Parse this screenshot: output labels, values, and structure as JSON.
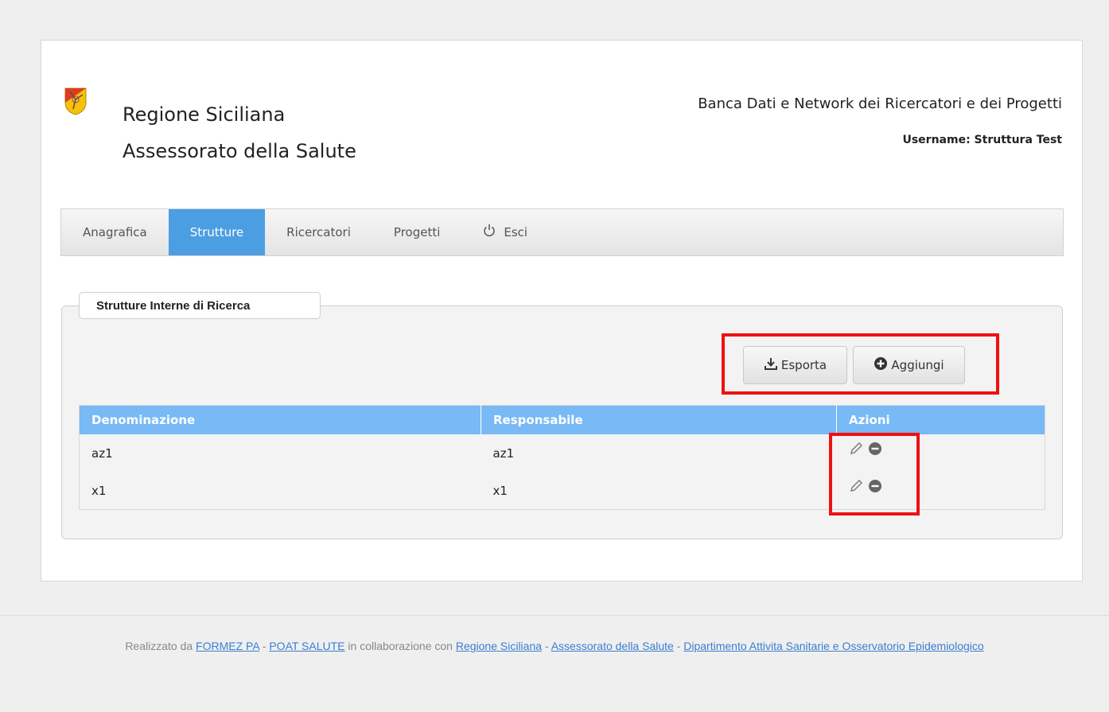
{
  "header": {
    "logo_icon": "trinacria-shield-logo",
    "org_line1": "Regione Siciliana",
    "org_line2": "Assessorato della Salute",
    "app_title": "Banca Dati e Network dei Ricercatori e dei Progetti",
    "username_label": "Username: Struttura Test"
  },
  "nav": {
    "items": [
      {
        "label": "Anagrafica",
        "active": false
      },
      {
        "label": "Strutture",
        "active": true
      },
      {
        "label": "Ricercatori",
        "active": false
      },
      {
        "label": "Progetti",
        "active": false
      },
      {
        "label": "Esci",
        "active": false,
        "icon": "power-icon"
      }
    ],
    "active_color": "#4c9ee2"
  },
  "section": {
    "legend": "Strutture Interne di Ricerca",
    "buttons": {
      "export_label": "Esporta",
      "export_icon": "download-icon",
      "add_label": "Aggiungi",
      "add_icon": "plus-circle-icon"
    }
  },
  "table": {
    "headers": [
      "Denominazione",
      "Responsabile",
      "Azioni"
    ],
    "header_color": "#78b9f6",
    "rows": [
      {
        "denominazione": "az1",
        "responsabile": "az1",
        "actions": [
          "edit-pencil-icon",
          "remove-circle-icon"
        ]
      },
      {
        "denominazione": "x1",
        "responsabile": "x1",
        "actions": [
          "edit-pencil-icon",
          "remove-circle-icon"
        ]
      }
    ]
  },
  "annotations": {
    "highlight_color": "#ee1111"
  },
  "footer": {
    "prefix": "Realizzato da",
    "link_formez": "FORMEZ PA",
    "sep1": "-",
    "link_poat": "POAT SALUTE",
    "middle": "in collaborazione con",
    "link_regione": "Regione Siciliana",
    "sep2": "-",
    "link_assessorato": "Assessorato della Salute",
    "sep3": "-",
    "link_dipartimento": "Dipartimento Attivita Sanitarie e Osservatorio Epidemiologico"
  }
}
